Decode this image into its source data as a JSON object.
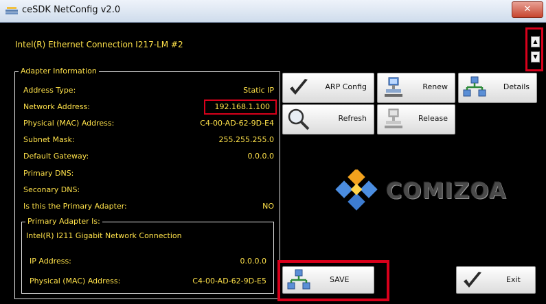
{
  "window": {
    "title": "ceSDK NetConfig v2.0",
    "close_label": "✕"
  },
  "adapter_select": {
    "value": "Intel(R) Ethernet Connection I217-LM #2"
  },
  "adapter_info": {
    "legend": "Adapter Information",
    "rows": [
      {
        "label": "Address Type:",
        "value": "Static IP"
      },
      {
        "label": "Network Address:",
        "value": "192.168.1.100"
      },
      {
        "label": "Physical (MAC) Address:",
        "value": "C4-00-AD-62-9D-E4"
      },
      {
        "label": "Subnet Mask:",
        "value": "255.255.255.0"
      },
      {
        "label": "Default Gateway:",
        "value": "0.0.0.0"
      },
      {
        "label": "Primary DNS:",
        "value": ""
      },
      {
        "label": "Seconary DNS:",
        "value": ""
      },
      {
        "label": "Is this the Primary Adapter:",
        "value": "NO"
      }
    ]
  },
  "primary_adapter": {
    "legend": "Primary Adapter Is:",
    "name": "Intel(R) I211 Gigabit Network Connection",
    "rows": [
      {
        "label": "IP Address:",
        "value": "0.0.0.0"
      },
      {
        "label": "Physical (MAC) Address:",
        "value": "C4-00-AD-62-9D-E5"
      }
    ]
  },
  "buttons": {
    "arp_config": "ARP Config",
    "renew": "Renew",
    "details": "Details",
    "refresh": "Refresh",
    "release": "Release",
    "save": "SAVE",
    "exit": "Exit"
  },
  "logo": {
    "text": "COMIZOA"
  },
  "colors": {
    "text": "#ffe24a",
    "background": "#000000",
    "highlight": "#d9001b"
  }
}
